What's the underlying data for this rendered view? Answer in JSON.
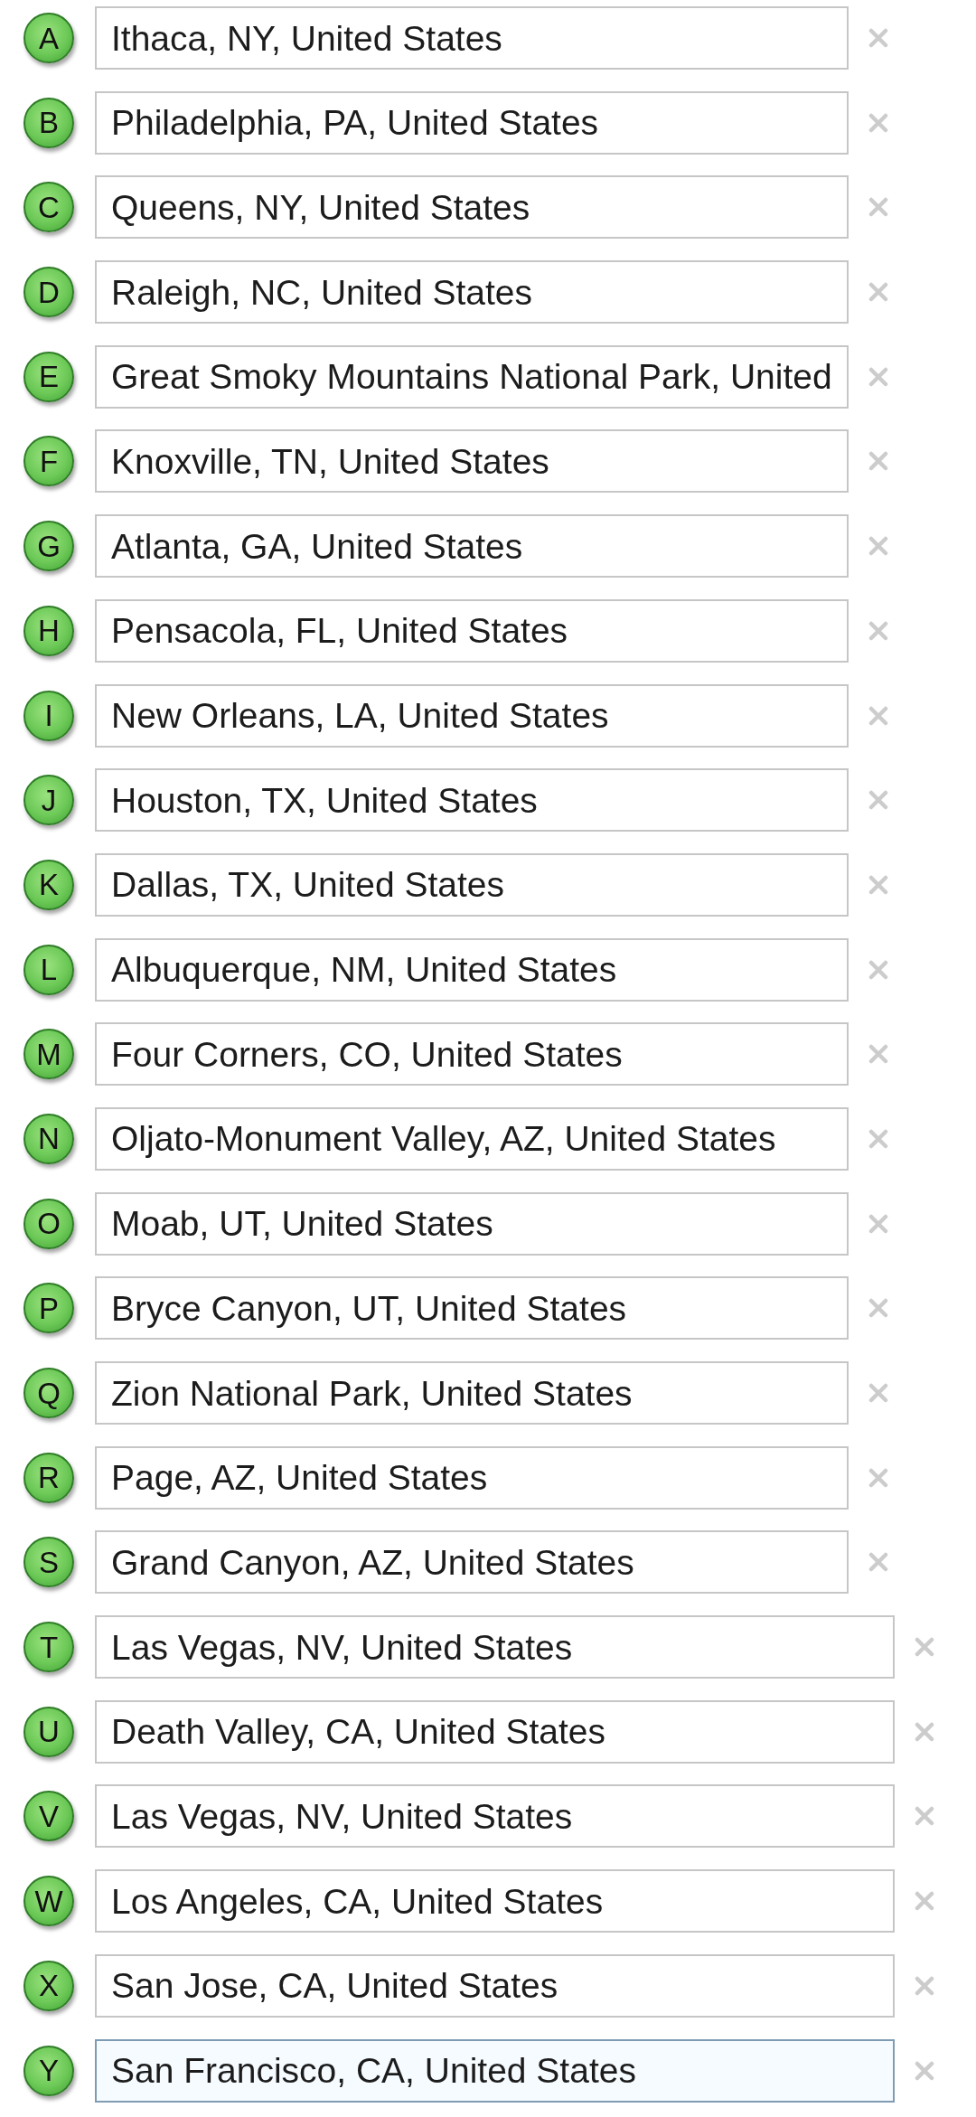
{
  "waypoints": [
    {
      "letter": "A",
      "location": "Ithaca, NY, United States",
      "kind": "narrow",
      "focused": false
    },
    {
      "letter": "B",
      "location": "Philadelphia, PA, United States",
      "kind": "narrow",
      "focused": false
    },
    {
      "letter": "C",
      "location": "Queens, NY, United States",
      "kind": "narrow",
      "focused": false
    },
    {
      "letter": "D",
      "location": "Raleigh, NC, United States",
      "kind": "narrow",
      "focused": false
    },
    {
      "letter": "E",
      "location": "Great Smoky Mountains National Park, United",
      "kind": "narrow",
      "focused": false
    },
    {
      "letter": "F",
      "location": "Knoxville, TN, United States",
      "kind": "narrow",
      "focused": false
    },
    {
      "letter": "G",
      "location": "Atlanta, GA, United States",
      "kind": "narrow",
      "focused": false
    },
    {
      "letter": "H",
      "location": "Pensacola, FL, United States",
      "kind": "narrow",
      "focused": false
    },
    {
      "letter": "I",
      "location": "New Orleans, LA, United States",
      "kind": "narrow",
      "focused": false
    },
    {
      "letter": "J",
      "location": "Houston, TX, United States",
      "kind": "narrow",
      "focused": false
    },
    {
      "letter": "K",
      "location": "Dallas, TX, United States",
      "kind": "narrow",
      "focused": false
    },
    {
      "letter": "L",
      "location": "Albuquerque, NM, United States",
      "kind": "narrow",
      "focused": false
    },
    {
      "letter": "M",
      "location": "Four Corners, CO, United States",
      "kind": "narrow",
      "focused": false
    },
    {
      "letter": "N",
      "location": "Oljato-Monument Valley, AZ, United States",
      "kind": "narrow",
      "focused": false
    },
    {
      "letter": "O",
      "location": "Moab, UT, United States",
      "kind": "narrow",
      "focused": false
    },
    {
      "letter": "P",
      "location": "Bryce Canyon, UT, United States",
      "kind": "narrow",
      "focused": false
    },
    {
      "letter": "Q",
      "location": "Zion National Park, United States",
      "kind": "narrow",
      "focused": false
    },
    {
      "letter": "R",
      "location": "Page, AZ, United States",
      "kind": "narrow",
      "focused": false
    },
    {
      "letter": "S",
      "location": "Grand Canyon, AZ, United States",
      "kind": "narrow",
      "focused": false
    },
    {
      "letter": "T",
      "location": "Las Vegas, NV, United States",
      "kind": "wide",
      "focused": false
    },
    {
      "letter": "U",
      "location": "Death Valley, CA, United States",
      "kind": "wide",
      "focused": false
    },
    {
      "letter": "V",
      "location": "Las Vegas, NV, United States",
      "kind": "wide",
      "focused": false
    },
    {
      "letter": "W",
      "location": "Los Angeles, CA, United States",
      "kind": "wide",
      "focused": false
    },
    {
      "letter": "X",
      "location": "San Jose, CA, United States",
      "kind": "wide",
      "focused": false
    },
    {
      "letter": "Y",
      "location": "San Francisco, CA, United States",
      "kind": "wide",
      "focused": true
    }
  ]
}
